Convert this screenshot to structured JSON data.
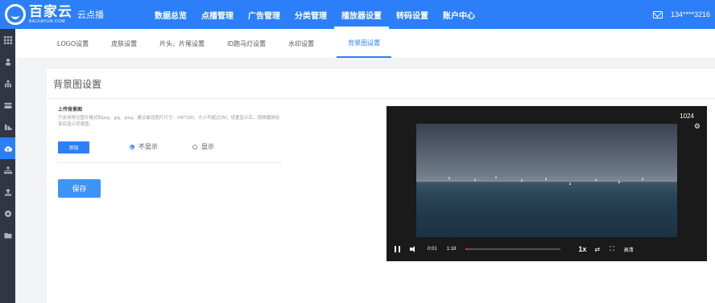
{
  "brand": {
    "name_cn": "百家云",
    "name_en": "BAIJIAYUN.COM",
    "product": "云点播"
  },
  "topnav": [
    {
      "label": "数据总览",
      "active": false
    },
    {
      "label": "点播管理",
      "active": false
    },
    {
      "label": "广告管理",
      "active": false
    },
    {
      "label": "分类管理",
      "active": false
    },
    {
      "label": "播放器设置",
      "active": true
    },
    {
      "label": "转码设置",
      "active": false
    },
    {
      "label": "账户中心",
      "active": false
    }
  ],
  "user": {
    "account": "134****3216",
    "icon": "mail-icon"
  },
  "sidebar": [
    {
      "icon": "grid-icon"
    },
    {
      "icon": "user-icon"
    },
    {
      "icon": "group-icon"
    },
    {
      "icon": "users-icon"
    },
    {
      "icon": "chart-icon"
    },
    {
      "icon": "cloud-upload-icon",
      "active": true
    },
    {
      "icon": "tree-icon"
    },
    {
      "icon": "upload-icon"
    },
    {
      "icon": "circle-icon"
    },
    {
      "icon": "folder-icon"
    }
  ],
  "tabs": [
    {
      "label": "LOGO设置",
      "active": false
    },
    {
      "label": "皮肤设置",
      "active": false
    },
    {
      "label": "片头、片尾设置",
      "active": false
    },
    {
      "label": "ID跑马灯设置",
      "active": false
    },
    {
      "label": "水印设置",
      "active": false
    },
    {
      "label": "背景图设置",
      "active": true
    }
  ],
  "section": {
    "title": "背景图设置",
    "upload_label": "上传背景图",
    "upload_desc": "只支持常见图片格式如png、jpg、jpeg，建议最佳图片尺寸：240*180，大小不超过2M；设置显示后，视频播放结束后显示背景图。",
    "add_button": "添加",
    "radio_hide": "不显示",
    "radio_show": "显示",
    "selected": "hide",
    "save_button": "保存"
  },
  "player": {
    "resolution_badge": "1024",
    "current_time": "0:01",
    "duration": "1:18",
    "progress": 0.013,
    "rate": "1x",
    "quality": "高清",
    "colors": {
      "progress": "#e0187a"
    }
  },
  "colors": {
    "accent": "#2d7ff9",
    "sidebar": "#303644"
  }
}
